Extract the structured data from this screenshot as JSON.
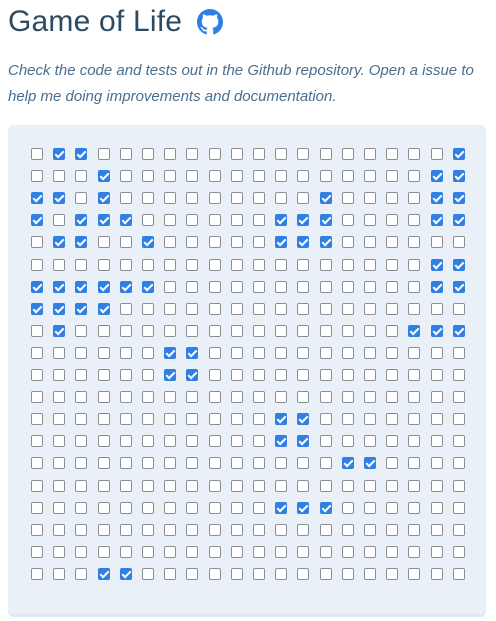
{
  "header": {
    "title": "Game of Life",
    "github_icon": "github-icon"
  },
  "description": "Check the code and tests out in the Github repository. Open a issue to help me doing improvements and documentation.",
  "board": {
    "columns": 20,
    "rows": 20,
    "checked_color": "#2f7fe5",
    "unchecked_color": "#ffffff",
    "cells": [
      "01100000000000000001",
      "00010000000000000011",
      "11010000000001000011",
      "10111000000111000011",
      "01100100000111000000",
      "00000000000000000011",
      "11111100000000000011",
      "11110000000000000000",
      "01000000000000000111",
      "00000011000000000000",
      "00000011000000000000",
      "00000000000000000000",
      "00000000000110000000",
      "00000000000110000000",
      "00000000000000110000",
      "00000000000000000000",
      "00000000000111000000",
      "00000000000000000000",
      "00000000000000000000",
      "00011000000000000000"
    ]
  }
}
